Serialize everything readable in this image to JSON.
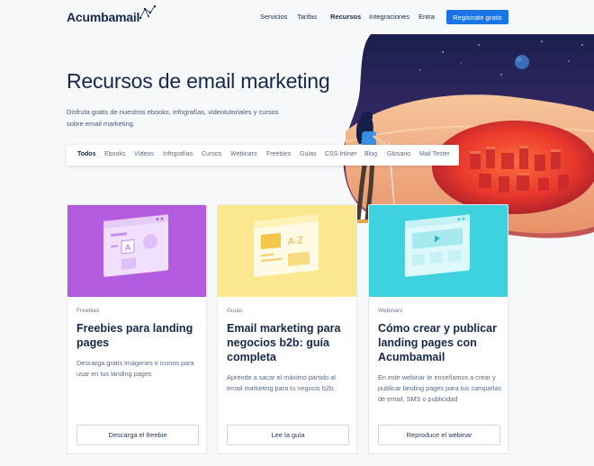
{
  "brand": {
    "name": "Acumbamail"
  },
  "nav": {
    "items": [
      "Servicios",
      "Tarifas",
      "Recursos",
      "Integraciones",
      "Entra"
    ],
    "active": "Recursos",
    "cta": "Registrate gratis"
  },
  "hero": {
    "title": "Recursos de email marketing",
    "subtitle": "Disfruta gratis de nuestros ebooks, infografías, videotutoriales y cursos sobre email marketing."
  },
  "filters": {
    "items": [
      "Todos",
      "Ebooks",
      "Vídeos",
      "Infografías",
      "Cursos",
      "Webinars",
      "Freebies",
      "Guías",
      "CSS Inliner",
      "Blog",
      "Glosario",
      "Mail Tester"
    ],
    "selected": "Todos"
  },
  "cards": [
    {
      "category": "Freebies",
      "title": "Freebies para landing pages",
      "description": "Descarga gratis imágenes e iconos para usar en tus landing pages",
      "button": "Descarga el freebie",
      "color": "#b35ce0"
    },
    {
      "category": "Guías",
      "title": "Email marketing para negocios b2b: guía completa",
      "description": "Aprende a sacar el máximo partido al email marketing para tu negocio b2b.",
      "button": "Lee la guía",
      "color": "#fbe88e"
    },
    {
      "category": "Webinars",
      "title": "Cómo crear y publicar landing pages con Acumbamail",
      "description": "En este webinar te enseñamos a crear y publicar landing pages para tus campañas de email, SMS o publicidad",
      "button": "Reproduce el webinar",
      "color": "#3dd2de"
    }
  ],
  "colors": {
    "accent": "#1a74e8",
    "text": "#15284b",
    "background": "#f6f8fa"
  }
}
